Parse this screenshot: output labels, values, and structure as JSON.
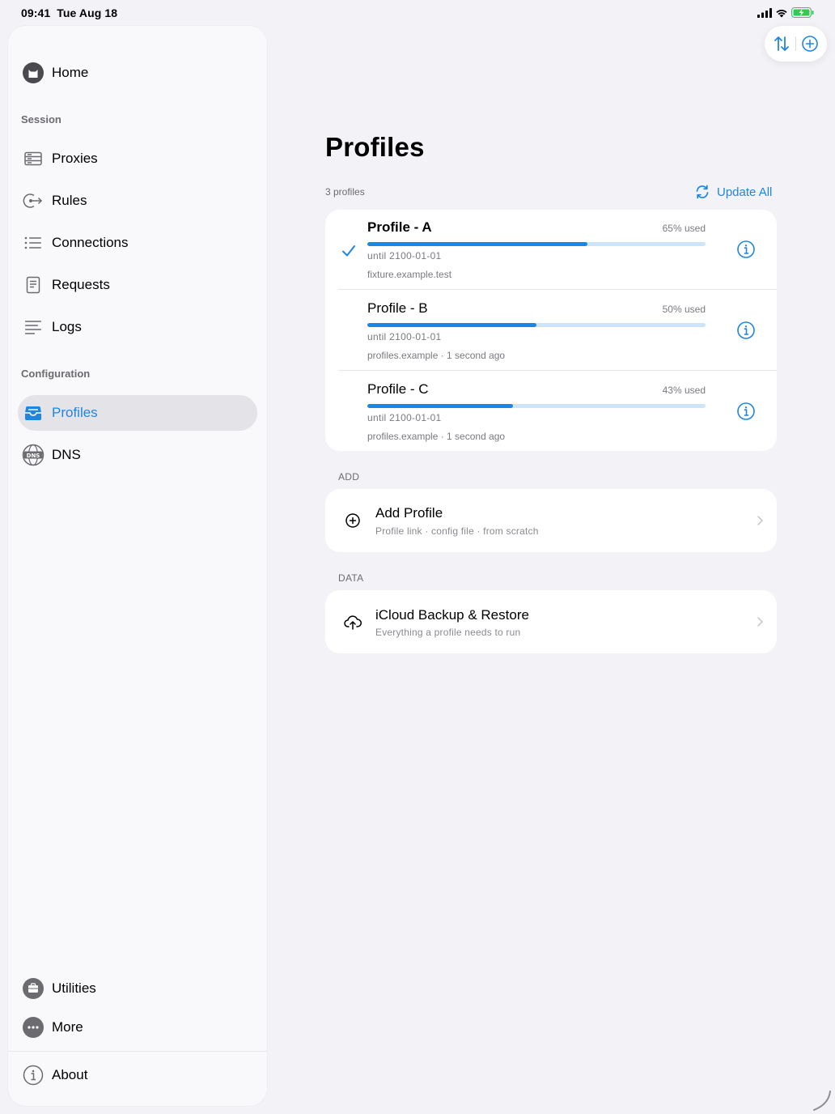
{
  "status": {
    "time": "09:41",
    "date": "Tue Aug 18"
  },
  "sidebar": {
    "home": "Home",
    "section_session": "Session",
    "items_session": [
      "Proxies",
      "Rules",
      "Connections",
      "Requests",
      "Logs"
    ],
    "section_config": "Configuration",
    "profiles": "Profiles",
    "dns": "DNS",
    "utilities": "Utilities",
    "more": "More",
    "about": "About"
  },
  "main": {
    "title": "Profiles",
    "count": "3 profiles",
    "update_all": "Update All",
    "profiles": [
      {
        "name": "Profile - A",
        "usage": "65% used",
        "usage_fraction": 0.65,
        "until": "until 2100-01-01",
        "source": "fixture.example.test",
        "selected": true
      },
      {
        "name": "Profile - B",
        "usage": "50% used",
        "usage_fraction": 0.5,
        "until": "until 2100-01-01",
        "source": "profiles.example · 1 second ago",
        "selected": false
      },
      {
        "name": "Profile - C",
        "usage": "43% used",
        "usage_fraction": 0.43,
        "until": "until 2100-01-01",
        "source": "profiles.example · 1 second ago",
        "selected": false
      }
    ],
    "add_section": "ADD",
    "add_title": "Add Profile",
    "add_sub": "Profile link · config file · from scratch",
    "data_section": "DATA",
    "icloud_title": "iCloud Backup & Restore",
    "icloud_sub": "Everything a profile needs to run"
  },
  "colors": {
    "accent": "#1f86e0",
    "bar_fill": "#1a86e6",
    "bar_track": "#cde5fa"
  },
  "icons": {
    "toolbar": [
      "sort-arrows-icon",
      "plus-circle-icon"
    ],
    "sidebar": [
      "cat-avatar-icon",
      "server-stack-icon",
      "rules-arrow-icon",
      "list-icon",
      "doc-icon",
      "text-lines-icon",
      "tray-icon",
      "dns-globe-icon",
      "toolbox-icon",
      "ellipsis-circle-icon",
      "info-circle-icon"
    ]
  }
}
